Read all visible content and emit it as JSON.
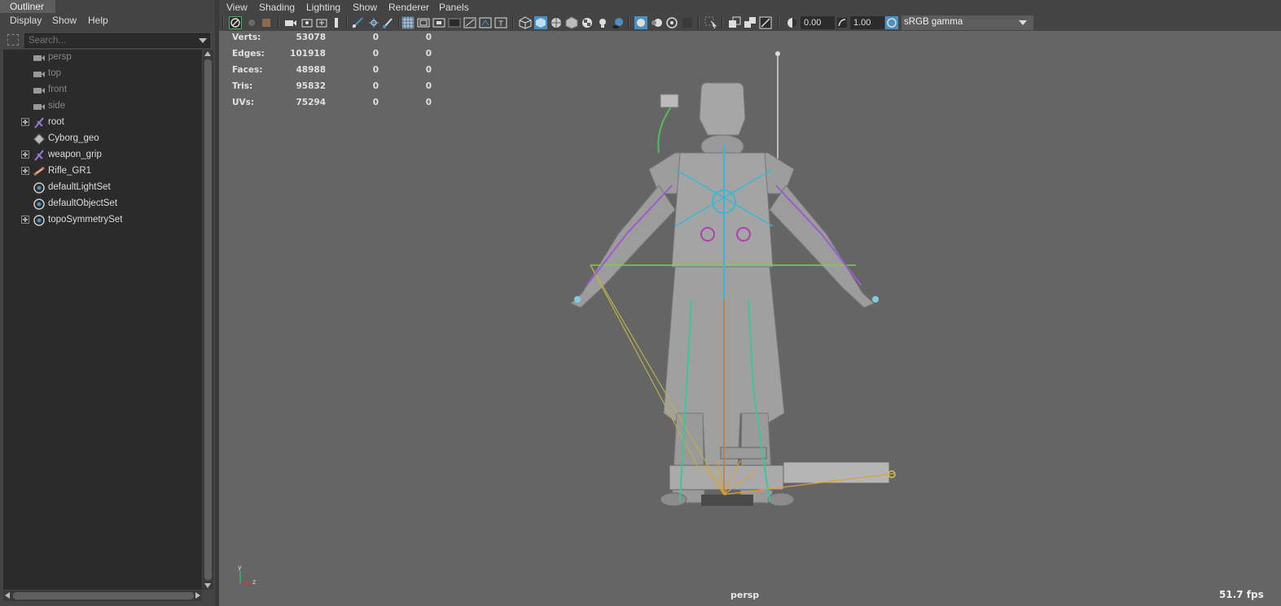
{
  "outliner": {
    "tab_label": "Outliner",
    "menu": [
      {
        "label": "Display"
      },
      {
        "label": "Show"
      },
      {
        "label": "Help"
      }
    ],
    "search": {
      "placeholder": "Search..."
    },
    "items": [
      {
        "label": "persp",
        "icon": "camera-icon",
        "expandable": false,
        "dim": true
      },
      {
        "label": "top",
        "icon": "camera-icon",
        "expandable": false,
        "dim": true
      },
      {
        "label": "front",
        "icon": "camera-icon",
        "expandable": false,
        "dim": true
      },
      {
        "label": "side",
        "icon": "camera-icon",
        "expandable": false,
        "dim": true
      },
      {
        "label": "root",
        "icon": "joint-icon",
        "expandable": true,
        "dim": false
      },
      {
        "label": "Cyborg_geo",
        "icon": "mesh-icon",
        "expandable": false,
        "dim": false
      },
      {
        "label": "weapon_grip",
        "icon": "joint-icon",
        "expandable": true,
        "dim": false
      },
      {
        "label": "Rifle_GR1",
        "icon": "rifle-icon",
        "expandable": true,
        "dim": false
      },
      {
        "label": "defaultLightSet",
        "icon": "set-icon",
        "expandable": false,
        "dim": false
      },
      {
        "label": "defaultObjectSet",
        "icon": "set-icon",
        "expandable": false,
        "dim": false
      },
      {
        "label": "topoSymmetrySet",
        "icon": "set-icon",
        "expandable": true,
        "dim": false
      }
    ]
  },
  "panel": {
    "menu": [
      {
        "label": "View"
      },
      {
        "label": "Shading"
      },
      {
        "label": "Lighting"
      },
      {
        "label": "Show"
      },
      {
        "label": "Renderer"
      },
      {
        "label": "Panels"
      }
    ],
    "toolbar": {
      "exposure_value": "0.00",
      "gamma_value": "1.00",
      "colorspace": "sRGB gamma"
    }
  },
  "viewport": {
    "hud": [
      {
        "label": "Verts:",
        "v1": "53078",
        "v2": "0",
        "v3": "0"
      },
      {
        "label": "Edges:",
        "v1": "101918",
        "v2": "0",
        "v3": "0"
      },
      {
        "label": "Faces:",
        "v1": "48988",
        "v2": "0",
        "v3": "0"
      },
      {
        "label": "Tris:",
        "v1": "95832",
        "v2": "0",
        "v3": "0"
      },
      {
        "label": "UVs:",
        "v1": "75294",
        "v2": "0",
        "v3": "0"
      }
    ],
    "camera": "persp",
    "fps": "51.7 fps",
    "axis_labels": {
      "y": "y",
      "z": "z"
    }
  },
  "colors": {
    "panel_bg": "#444444",
    "viewport_bg": "#656565",
    "outliner_bg": "#2b2b2b",
    "accent_blue": "#4a90c2",
    "accent_green": "#43b35a"
  }
}
